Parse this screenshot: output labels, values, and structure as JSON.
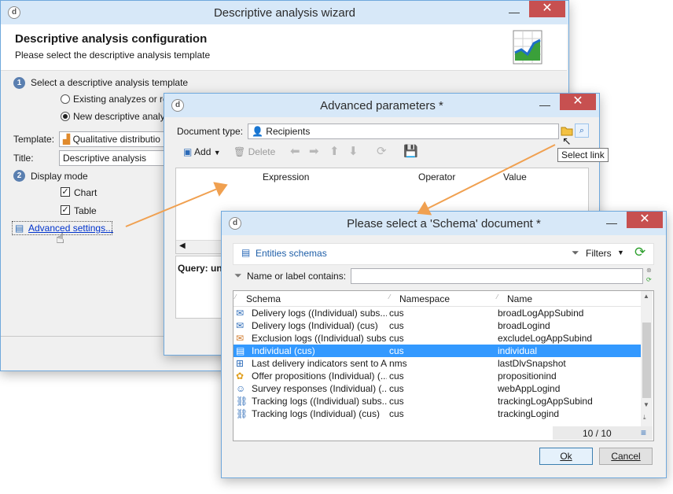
{
  "wizard": {
    "title": "Descriptive analysis wizard",
    "heading": "Descriptive analysis configuration",
    "subheading": "Please select the descriptive analysis template",
    "step1_label": "Select a descriptive analysis template",
    "step1_num": "1",
    "option_existing": "Existing analyzes or re",
    "option_new": "New descriptive analysi",
    "template_label": "Template:",
    "template_value": "Qualitative distributio",
    "title_label": "Title:",
    "title_value": "Descriptive analysis",
    "step2_label": "Display mode",
    "step2_num": "2",
    "chart_label": "Chart",
    "table_label": "Table",
    "advanced_link": "Advanced settings..."
  },
  "advanced": {
    "title": "Advanced parameters *",
    "doc_type_label": "Document type:",
    "doc_type_value": "Recipients",
    "toolbar": {
      "add": "Add",
      "delete": "Delete"
    },
    "columns": [
      "Expression",
      "Operator",
      "Value"
    ],
    "query_label": "Query: un",
    "tooltip": "Select link"
  },
  "schema_dialog": {
    "title": "Please select a 'Schema' document *",
    "entities_link": "Entities schemas",
    "filters_label": "Filters",
    "filter_label": "Name or label contains:",
    "filter_value": "",
    "columns": [
      "Schema",
      "Namespace",
      "Name"
    ],
    "rows": [
      {
        "schema": "Delivery logs ((Individual) subs...",
        "namespace": "cus",
        "name": "broadLogAppSubind",
        "icon": "delivery-log-icon"
      },
      {
        "schema": "Delivery logs (Individual) (cus)",
        "namespace": "cus",
        "name": "broadLogind",
        "icon": "delivery-log-icon"
      },
      {
        "schema": "Exclusion logs ((Individual) subs...",
        "namespace": "cus",
        "name": "excludeLogAppSubind",
        "icon": "exclusion-log-icon"
      },
      {
        "schema": "Individual (cus)",
        "namespace": "cus",
        "name": "individual",
        "icon": "individual-icon",
        "selected": true
      },
      {
        "schema": "Last delivery indicators sent to An",
        "namespace": "nms",
        "name": "lastDlvSnapshot",
        "icon": "indicator-icon"
      },
      {
        "schema": "Offer propositions (Individual) (...",
        "namespace": "cus",
        "name": "propositionind",
        "icon": "offer-icon"
      },
      {
        "schema": "Survey responses (Individual) (...",
        "namespace": "cus",
        "name": "webAppLogind",
        "icon": "survey-icon"
      },
      {
        "schema": "Tracking logs ((Individual) subs...",
        "namespace": "cus",
        "name": "trackingLogAppSubind",
        "icon": "tracking-log-icon"
      },
      {
        "schema": "Tracking logs (Individual) (cus)",
        "namespace": "cus",
        "name": "trackingLogind",
        "icon": "tracking-log-icon"
      }
    ],
    "count": "10 / 10",
    "ok": "Ok",
    "cancel": "Cancel"
  },
  "colors": {
    "accent": "#3399ff",
    "title_bar": "#d7e8f8",
    "close": "#c75050",
    "arrow": "#f0a050",
    "link": "#0033cc"
  }
}
